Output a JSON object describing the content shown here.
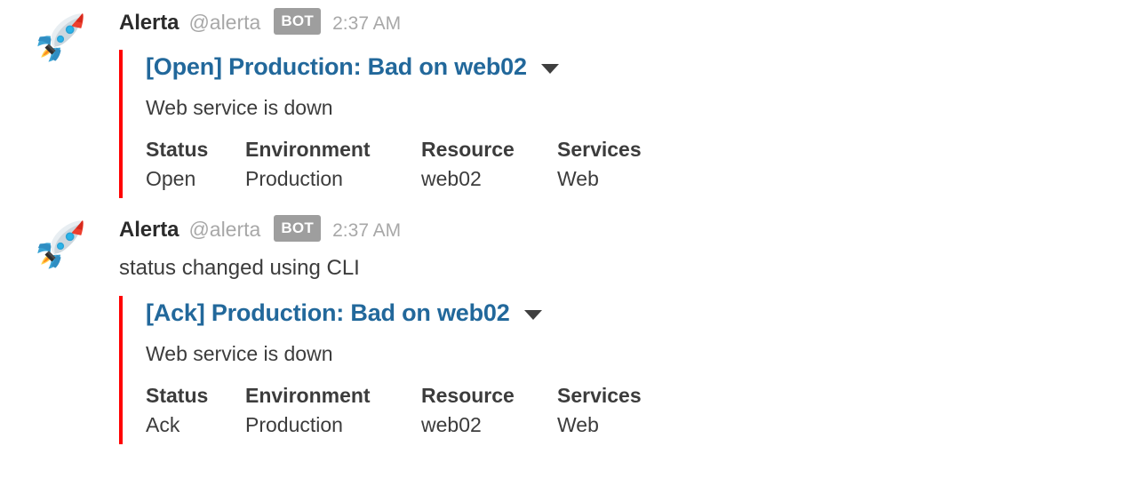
{
  "messages": [
    {
      "avatar_icon": "rocket-emoji",
      "username": "Alerta",
      "handle": "@alerta",
      "badge": "BOT",
      "timestamp": "2:37 AM",
      "text": "",
      "attachment": {
        "bar_color": "#ff0000",
        "title": "[Open] Production: Bad on web02",
        "title_color": "#22689b",
        "caret_icon": "chevron-down-icon",
        "text": "Web service is down",
        "fields": [
          {
            "title": "Status",
            "value": "Open"
          },
          {
            "title": "Environment",
            "value": "Production"
          },
          {
            "title": "Resource",
            "value": "web02"
          },
          {
            "title": "Services",
            "value": "Web"
          }
        ]
      }
    },
    {
      "avatar_icon": "rocket-emoji",
      "username": "Alerta",
      "handle": "@alerta",
      "badge": "BOT",
      "timestamp": "2:37 AM",
      "text": "status changed using CLI",
      "attachment": {
        "bar_color": "#ff0000",
        "title": "[Ack] Production: Bad on web02",
        "title_color": "#22689b",
        "caret_icon": "chevron-down-icon",
        "text": "Web service is down",
        "fields": [
          {
            "title": "Status",
            "value": "Ack"
          },
          {
            "title": "Environment",
            "value": "Production"
          },
          {
            "title": "Resource",
            "value": "web02"
          },
          {
            "title": "Services",
            "value": "Web"
          }
        ]
      }
    }
  ]
}
